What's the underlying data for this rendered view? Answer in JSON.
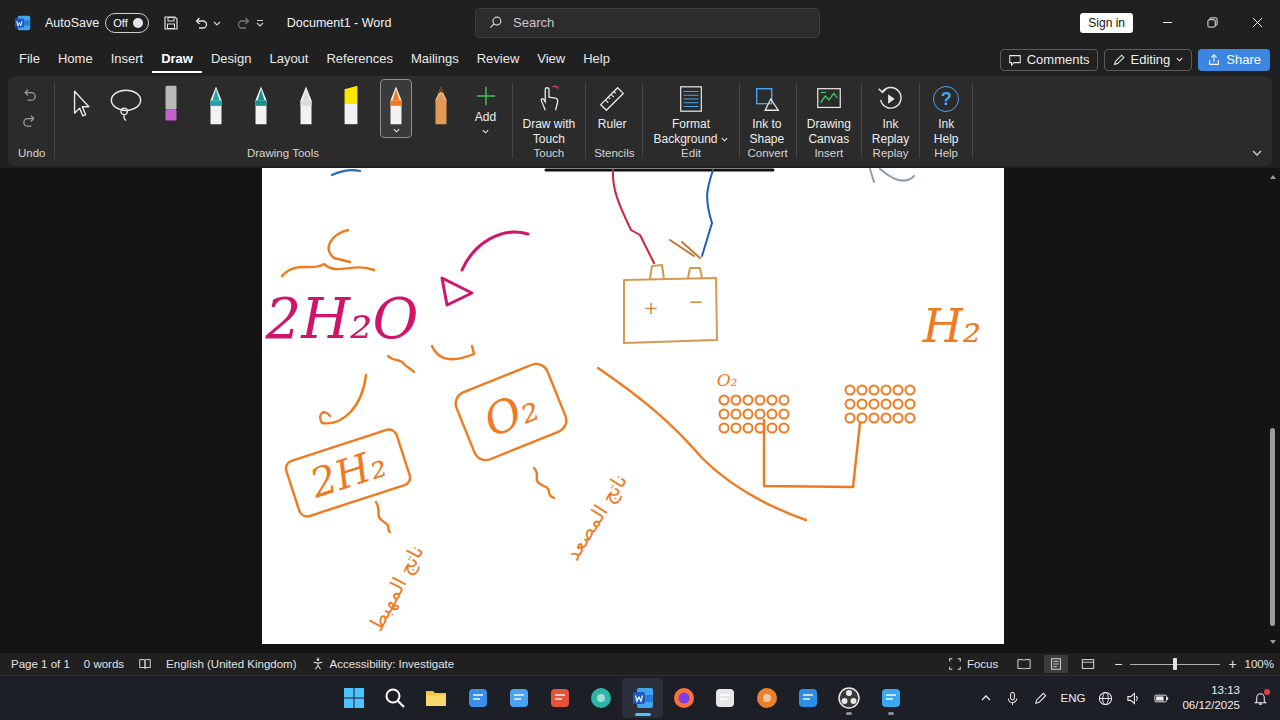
{
  "window": {
    "title": "Document1 - Word"
  },
  "title_bar": {
    "autosave": {
      "label": "AutoSave",
      "on": false,
      "state": "Off"
    },
    "search": {
      "placeholder": "Search"
    },
    "sign_in": "Sign in"
  },
  "menu": {
    "tabs": [
      {
        "label": "File",
        "selected": false
      },
      {
        "label": "Home",
        "selected": false
      },
      {
        "label": "Insert",
        "selected": false
      },
      {
        "label": "Draw",
        "selected": true
      },
      {
        "label": "Design",
        "selected": false
      },
      {
        "label": "Layout",
        "selected": false
      },
      {
        "label": "References",
        "selected": false
      },
      {
        "label": "Mailings",
        "selected": false
      },
      {
        "label": "Review",
        "selected": false
      },
      {
        "label": "View",
        "selected": false
      },
      {
        "label": "Help",
        "selected": false
      }
    ],
    "comments": "Comments",
    "editing": {
      "label": "Editing",
      "dropdown": true
    },
    "share": "Share"
  },
  "ribbon": {
    "groups": [
      {
        "label": "Undo",
        "kind": "undo"
      },
      {
        "label": "Drawing Tools",
        "kind": "tools",
        "tools": [
          {
            "kind": "select",
            "selected": false
          },
          {
            "kind": "lasso",
            "selected": false
          },
          {
            "kind": "eraser",
            "selected": false
          },
          {
            "kind": "pen",
            "color": "#1fa3a8",
            "selected": false
          },
          {
            "kind": "pen",
            "color": "#178f8c",
            "selected": false
          },
          {
            "kind": "pen",
            "color": "#dcdcdc",
            "selected": false
          },
          {
            "kind": "highlighter",
            "color": "#ffe600",
            "selected": false
          },
          {
            "kind": "pen",
            "color": "#f47a1f",
            "selected": true
          },
          {
            "kind": "pencil",
            "color": "#e39a55",
            "selected": false
          }
        ],
        "add": {
          "label": "Add",
          "dropdown": true
        }
      },
      {
        "label": "Touch",
        "kind": "button",
        "button": {
          "kind": "touch",
          "lines": [
            "Draw with",
            "Touch"
          ],
          "dropdown": false
        }
      },
      {
        "label": "Stencils",
        "kind": "button",
        "button": {
          "kind": "ruler",
          "lines": [
            "Ruler"
          ],
          "dropdown": false
        }
      },
      {
        "label": "Edit",
        "kind": "button",
        "button": {
          "kind": "background",
          "lines": [
            "Format",
            "Background"
          ],
          "dropdown": true
        }
      },
      {
        "label": "Convert",
        "kind": "button",
        "button": {
          "kind": "ink-shape",
          "lines": [
            "Ink to",
            "Shape"
          ],
          "dropdown": false
        }
      },
      {
        "label": "Insert",
        "kind": "button",
        "button": {
          "kind": "canvas",
          "lines": [
            "Drawing",
            "Canvas"
          ],
          "dropdown": false
        }
      },
      {
        "label": "Replay",
        "kind": "button",
        "button": {
          "kind": "replay",
          "lines": [
            "Ink",
            "Replay"
          ],
          "dropdown": false
        }
      },
      {
        "label": "Help",
        "kind": "button",
        "button": {
          "kind": "help",
          "lines": [
            "Ink",
            "Help"
          ],
          "dropdown": false,
          "glyph": "?"
        }
      }
    ]
  },
  "canvas": {
    "labels": [
      {
        "text": "2H₂O",
        "color": "#d0146c"
      },
      {
        "text": "O₂",
        "color": "#f07a1f"
      },
      {
        "text": "2H₂",
        "color": "#f07a1f"
      },
      {
        "text": "ناتج المصعد",
        "color": "#f07a1f"
      },
      {
        "text": "ناتج المهبط",
        "color": "#f07a1f"
      },
      {
        "text": "O₂",
        "color": "#f07a1f"
      },
      {
        "text": "H₂",
        "color": "#f07a1f"
      }
    ],
    "battery": {
      "plus": "+",
      "minus": "−"
    }
  },
  "scrollbar": {
    "offset": 0.54,
    "size": 0.44
  },
  "status_bar": {
    "page": "Page 1 of 1",
    "words": "0 words",
    "language": "English (United Kingdom)",
    "accessibility": "Accessibility: Investigate",
    "focus": "Focus",
    "views": [
      {
        "kind": "read",
        "selected": false
      },
      {
        "kind": "print",
        "selected": true
      },
      {
        "kind": "web",
        "selected": false
      }
    ],
    "zoom": {
      "minus": "−",
      "plus": "+",
      "level": 0.5,
      "reading": "100%"
    }
  },
  "taskbar": {
    "apps": [
      {
        "kind": "start",
        "active": false,
        "running": false,
        "color": "#4cc2ff"
      },
      {
        "kind": "search",
        "active": false,
        "running": false,
        "color": "#ffffff"
      },
      {
        "kind": "folder",
        "active": false,
        "running": false,
        "color": "#f6c344"
      },
      {
        "kind": "store",
        "active": false,
        "running": false,
        "color": "#3b8ee8"
      },
      {
        "kind": "notes",
        "active": false,
        "running": false,
        "color": "#4aa3f0"
      },
      {
        "kind": "snip",
        "active": false,
        "running": false,
        "color": "#e5533d"
      },
      {
        "kind": "globe",
        "active": false,
        "running": false,
        "color": "#2fb5a5"
      },
      {
        "kind": "word",
        "active": true,
        "running": true,
        "color": "#2b7cd3"
      },
      {
        "kind": "firefox",
        "active": false,
        "running": false,
        "color": "#ff7139"
      },
      {
        "kind": "chat",
        "active": false,
        "running": false,
        "color": "#e6e6e6"
      },
      {
        "kind": "circle",
        "active": false,
        "running": false,
        "color": "#e8812c"
      },
      {
        "kind": "paint",
        "active": false,
        "running": false,
        "color": "#2d8ee6"
      },
      {
        "kind": "obs",
        "active": false,
        "running": true,
        "color": "#3a3a3a"
      },
      {
        "kind": "app",
        "active": false,
        "running": true,
        "color": "#38a8f0"
      }
    ],
    "tray": {
      "language": "ENG",
      "time": "13:13",
      "date": "06/12/2025",
      "notification": true
    }
  }
}
